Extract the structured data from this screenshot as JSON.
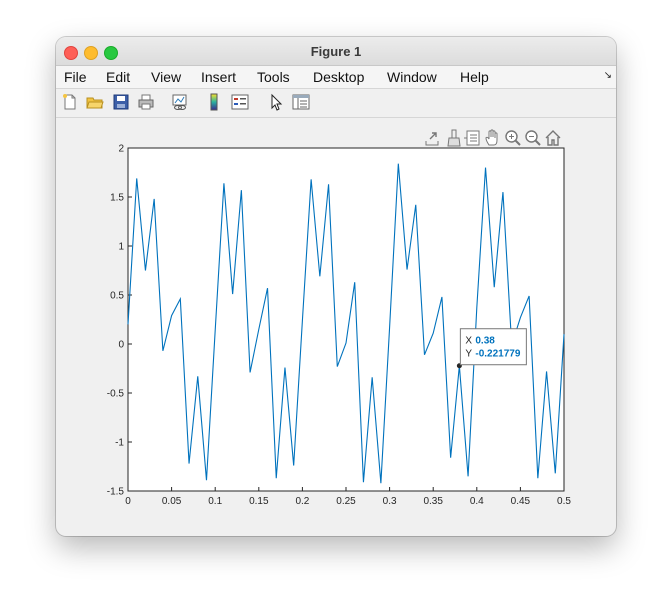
{
  "window": {
    "title": "Figure 1"
  },
  "menu": [
    "File",
    "Edit",
    "View",
    "Insert",
    "Tools",
    "Desktop",
    "Window",
    "Help"
  ],
  "toolbar_icons": [
    "new-figure-icon",
    "open-file-icon",
    "save-icon",
    "print-icon",
    "link-plot-icon",
    "colorbar-icon",
    "legend-icon",
    "edit-plot-icon",
    "property-inspector-icon"
  ],
  "axes_toolbar_icons": [
    "export-icon",
    "brush-icon",
    "datatips-icon",
    "pan-icon",
    "zoom-in-icon",
    "zoom-out-icon",
    "home-icon"
  ],
  "colors": {
    "line": "#0072bd",
    "datatip_value": "#0072bd"
  },
  "chart_data": {
    "type": "line",
    "xlim": [
      0,
      0.5
    ],
    "ylim": [
      -1.5,
      2
    ],
    "xticks": [
      "0",
      "0.05",
      "0.1",
      "0.15",
      "0.2",
      "0.25",
      "0.3",
      "0.35",
      "0.4",
      "0.45",
      "0.5"
    ],
    "yticks": [
      "-1.5",
      "-1",
      "-0.5",
      "0",
      "0.5",
      "1",
      "1.5",
      "2"
    ],
    "grid": false,
    "series": [
      {
        "x": [
          0,
          0.01,
          0.02,
          0.03,
          0.04,
          0.05,
          0.06,
          0.07,
          0.08,
          0.09,
          0.1,
          0.11,
          0.12,
          0.13,
          0.14,
          0.15,
          0.16,
          0.17,
          0.18,
          0.19,
          0.2,
          0.21,
          0.22,
          0.23,
          0.24,
          0.25,
          0.26,
          0.27,
          0.28,
          0.29,
          0.3,
          0.31,
          0.32,
          0.33,
          0.34,
          0.35,
          0.36,
          0.37,
          0.38,
          0.39,
          0.4,
          0.41,
          0.42,
          0.43,
          0.44,
          0.45,
          0.46,
          0.47,
          0.48,
          0.49,
          0.5
        ],
        "y": [
          0.2,
          1.69,
          0.75,
          1.48,
          -0.07,
          0.29,
          0.46,
          -1.22,
          -0.33,
          -1.39,
          0.14,
          1.64,
          0.51,
          1.57,
          -0.29,
          0.15,
          0.57,
          -1.37,
          -0.24,
          -1.24,
          0.24,
          1.68,
          0.69,
          1.63,
          -0.23,
          0.01,
          0.63,
          -1.41,
          -0.34,
          -1.42,
          0.17,
          1.84,
          0.76,
          1.42,
          -0.11,
          0.11,
          0.48,
          -1.16,
          -0.221779,
          -1.35,
          0.37,
          1.8,
          0.58,
          1.55,
          -0.01,
          0.27,
          0.49,
          -1.37,
          -0.28,
          -1.32,
          0.1
        ]
      }
    ],
    "datatip": {
      "x_label": "X",
      "x_value": "0.38",
      "y_label": "Y",
      "y_value": "-0.221779",
      "x": 0.38,
      "y": -0.221779
    }
  }
}
